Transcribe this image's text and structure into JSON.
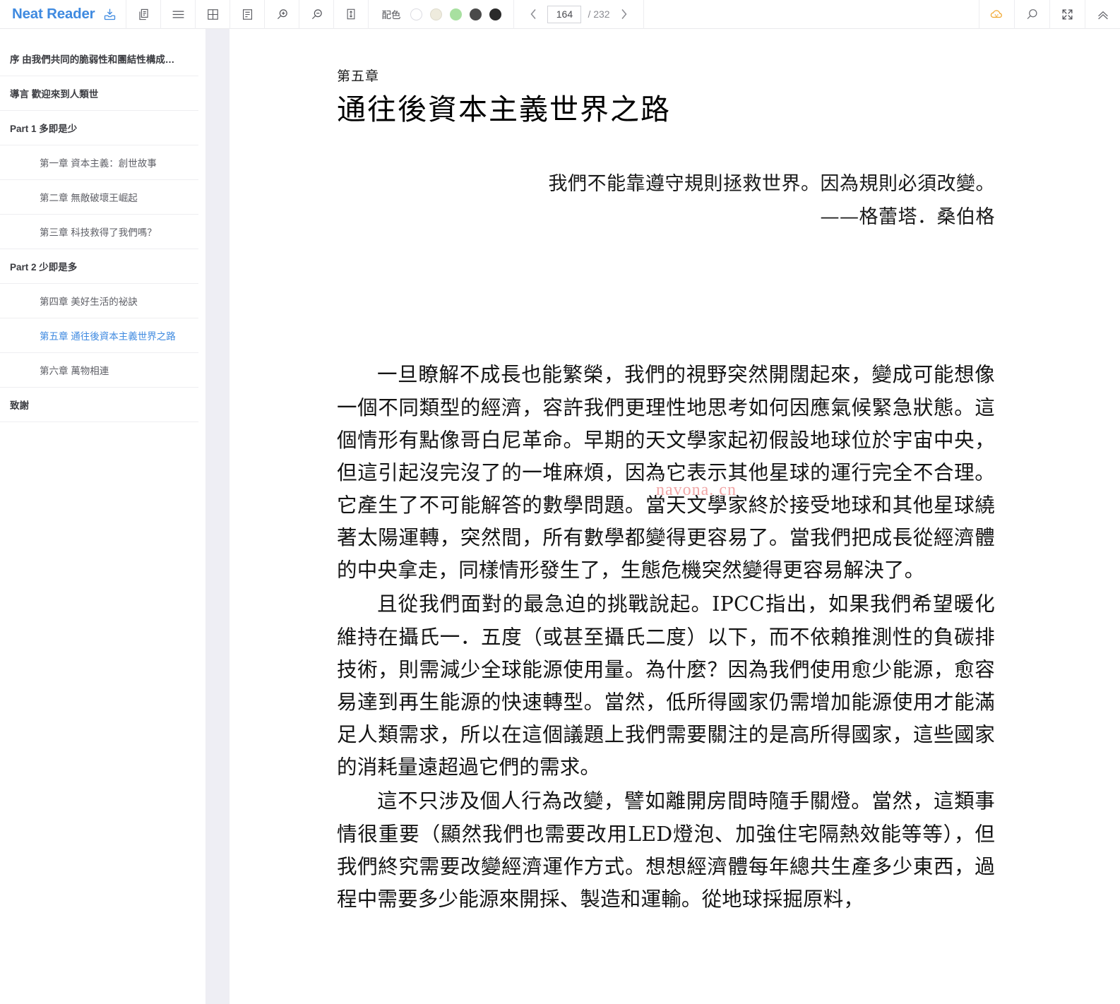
{
  "app": {
    "brand": "Neat Reader",
    "brand_color": "#3f8ae0",
    "brand_icon": "save-epub-icon"
  },
  "toolbar": {
    "buttons": [
      {
        "name": "copy-icon",
        "title": "复制"
      },
      {
        "name": "list-menu-icon",
        "title": "目录"
      },
      {
        "name": "grid-layout-icon",
        "title": "分栏"
      },
      {
        "name": "note-icon",
        "title": "笔记"
      },
      {
        "name": "zoom-in-icon",
        "title": "放大"
      },
      {
        "name": "zoom-out-icon",
        "title": "缩小"
      },
      {
        "name": "line-height-icon",
        "title": "行距"
      }
    ],
    "color_scheme": {
      "label": "配色",
      "swatches": [
        {
          "name": "theme-white",
          "color": "#ffffff",
          "border": "#dcdce2"
        },
        {
          "name": "theme-cream",
          "color": "#eeebdd",
          "border": "#dedbcd"
        },
        {
          "name": "theme-green",
          "color": "#a8e0a0",
          "border": "#a8e0a0"
        },
        {
          "name": "theme-gray",
          "color": "#4a4a4a",
          "border": "#4a4a4a"
        },
        {
          "name": "theme-black",
          "color": "#2a2a2a",
          "border": "#2a2a2a"
        }
      ]
    },
    "pager": {
      "prev_label": "‹",
      "next_label": "›",
      "current_page": "164",
      "total_label": "/ 232",
      "total_pages": "232"
    },
    "right_buttons": [
      {
        "name": "cloud-sync-icon",
        "title": "云同步",
        "color": "#f5a623"
      },
      {
        "name": "search-icon",
        "title": "搜索",
        "color": "#6b6c72"
      },
      {
        "name": "fullscreen-icon",
        "title": "全屏",
        "color": "#6b6c72"
      },
      {
        "name": "collapse-up-icon",
        "title": "收起",
        "color": "#6b6c72"
      }
    ]
  },
  "sidebar": {
    "items": [
      {
        "label": "序   由我們共同的脆弱性和團結性構成…",
        "level": 0,
        "active": false
      },
      {
        "label": "導言   歡迎來到人類世",
        "level": 0,
        "active": false
      },
      {
        "label": "Part 1   多即是少",
        "level": 0,
        "active": false
      },
      {
        "label": "第一章   資本主義：創世故事",
        "level": 1,
        "active": false
      },
      {
        "label": "第二章   無敵破壞王崛起",
        "level": 1,
        "active": false
      },
      {
        "label": "第三章   科技救得了我們嗎？",
        "level": 1,
        "active": false
      },
      {
        "label": "Part 2   少即是多",
        "level": 0,
        "active": false
      },
      {
        "label": "第四章   美好生活的祕訣",
        "level": 1,
        "active": false
      },
      {
        "label": "第五章   通往後資本主義世界之路",
        "level": 1,
        "active": true
      },
      {
        "label": "第六章   萬物相連",
        "level": 1,
        "active": false
      },
      {
        "label": "致謝",
        "level": 0,
        "active": false
      }
    ]
  },
  "content": {
    "chapter_number": "第五章",
    "chapter_title": "通往後資本主義世界之路",
    "epigraph_quote": "我們不能靠遵守規則拯救世界。因為規則必須改變。",
    "epigraph_source": "——格蕾塔．桑伯格",
    "paragraphs": [
      "一旦瞭解不成長也能繁榮，我們的視野突然開闊起來，變成可能想像一個不同類型的經濟，容許我們更理性地思考如何因應氣候緊急狀態。這個情形有點像哥白尼革命。早期的天文學家起初假設地球位於宇宙中央，但這引起沒完沒了的一堆麻煩，因為它表示其他星球的運行完全不合理。它產生了不可能解答的數學問題。當天文學家終於接受地球和其他星球繞著太陽運轉，突然間，所有數學都變得更容易了。當我們把成長從經濟體的中央拿走，同樣情形發生了，生態危機突然變得更容易解決了。",
      "且從我們面對的最急迫的挑戰說起。IPCC指出，如果我們希望暖化維持在攝氏一．五度（或甚至攝氏二度）以下，而不依賴推測性的負碳排技術，則需減少全球能源使用量。為什麼？因為我們使用愈少能源，愈容易達到再生能源的快速轉型。當然，低所得國家仍需增加能源使用才能滿足人類需求，所以在這個議題上我們需要關注的是高所得國家，這些國家的消耗量遠超過它們的需求。",
      "這不只涉及個人行為改變，譬如離開房間時隨手關燈。當然，這類事情很重要（顯然我們也需要改用LED燈泡、加強住宅隔熱效能等等），但我們終究需要改變經濟運作方式。想想經濟體每年總共生產多少東西，過程中需要多少能源來開採、製造和運輸。從地球採掘原料，"
    ],
    "watermark": "navona. cn"
  }
}
